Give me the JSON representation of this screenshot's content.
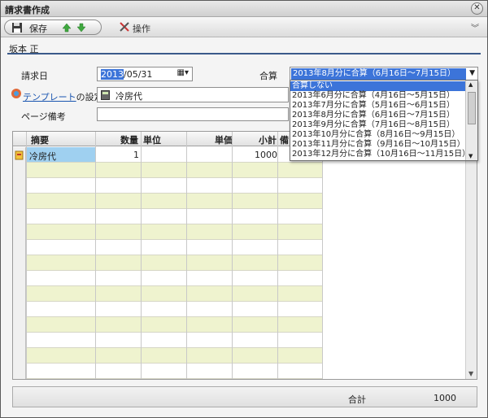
{
  "window": {
    "title": "請求書作成"
  },
  "toolbar": {
    "save_label": "保存",
    "ops_label": "操作"
  },
  "owner": {
    "name": "坂本 正"
  },
  "form": {
    "billing_date_label": "請求日",
    "billing_date_year_selected": "2013",
    "billing_date_rest": "/05/31",
    "combine_label": "合算",
    "combine_value": "2013年8月分に合算（6月16日～7月15日）",
    "template_link": "テンプレート",
    "template_suffix": "の設定",
    "template_value": "冷房代",
    "page_note_label": "ページ備考",
    "page_note_value": ""
  },
  "dropdown": {
    "options": [
      "合算しない",
      "2013年6月分に合算（4月16日～5月15日）",
      "2013年7月分に合算（5月16日～6月15日）",
      "2013年8月分に合算（6月16日～7月15日）",
      "2013年9月分に合算（7月16日～8月15日）",
      "2013年10月分に合算（8月16日～9月15日）",
      "2013年11月分に合算（9月16日～10月15日）",
      "2013年12月分に合算（10月16日～11月15日）"
    ]
  },
  "grid": {
    "headers": {
      "desc": "摘要",
      "qty": "数量",
      "unit": "単位",
      "price": "単価",
      "subtotal": "小計",
      "note": "備"
    },
    "rows": [
      {
        "desc": "冷房代",
        "qty": "1",
        "unit": "",
        "price": "",
        "subtotal": "1000",
        "note": ""
      }
    ]
  },
  "footer": {
    "total_label": "合計",
    "total_value": "1000"
  },
  "colors": {
    "selection": "#3c74d9",
    "alt_row": "#eff3cf",
    "header_line": "#3a5a8a"
  }
}
